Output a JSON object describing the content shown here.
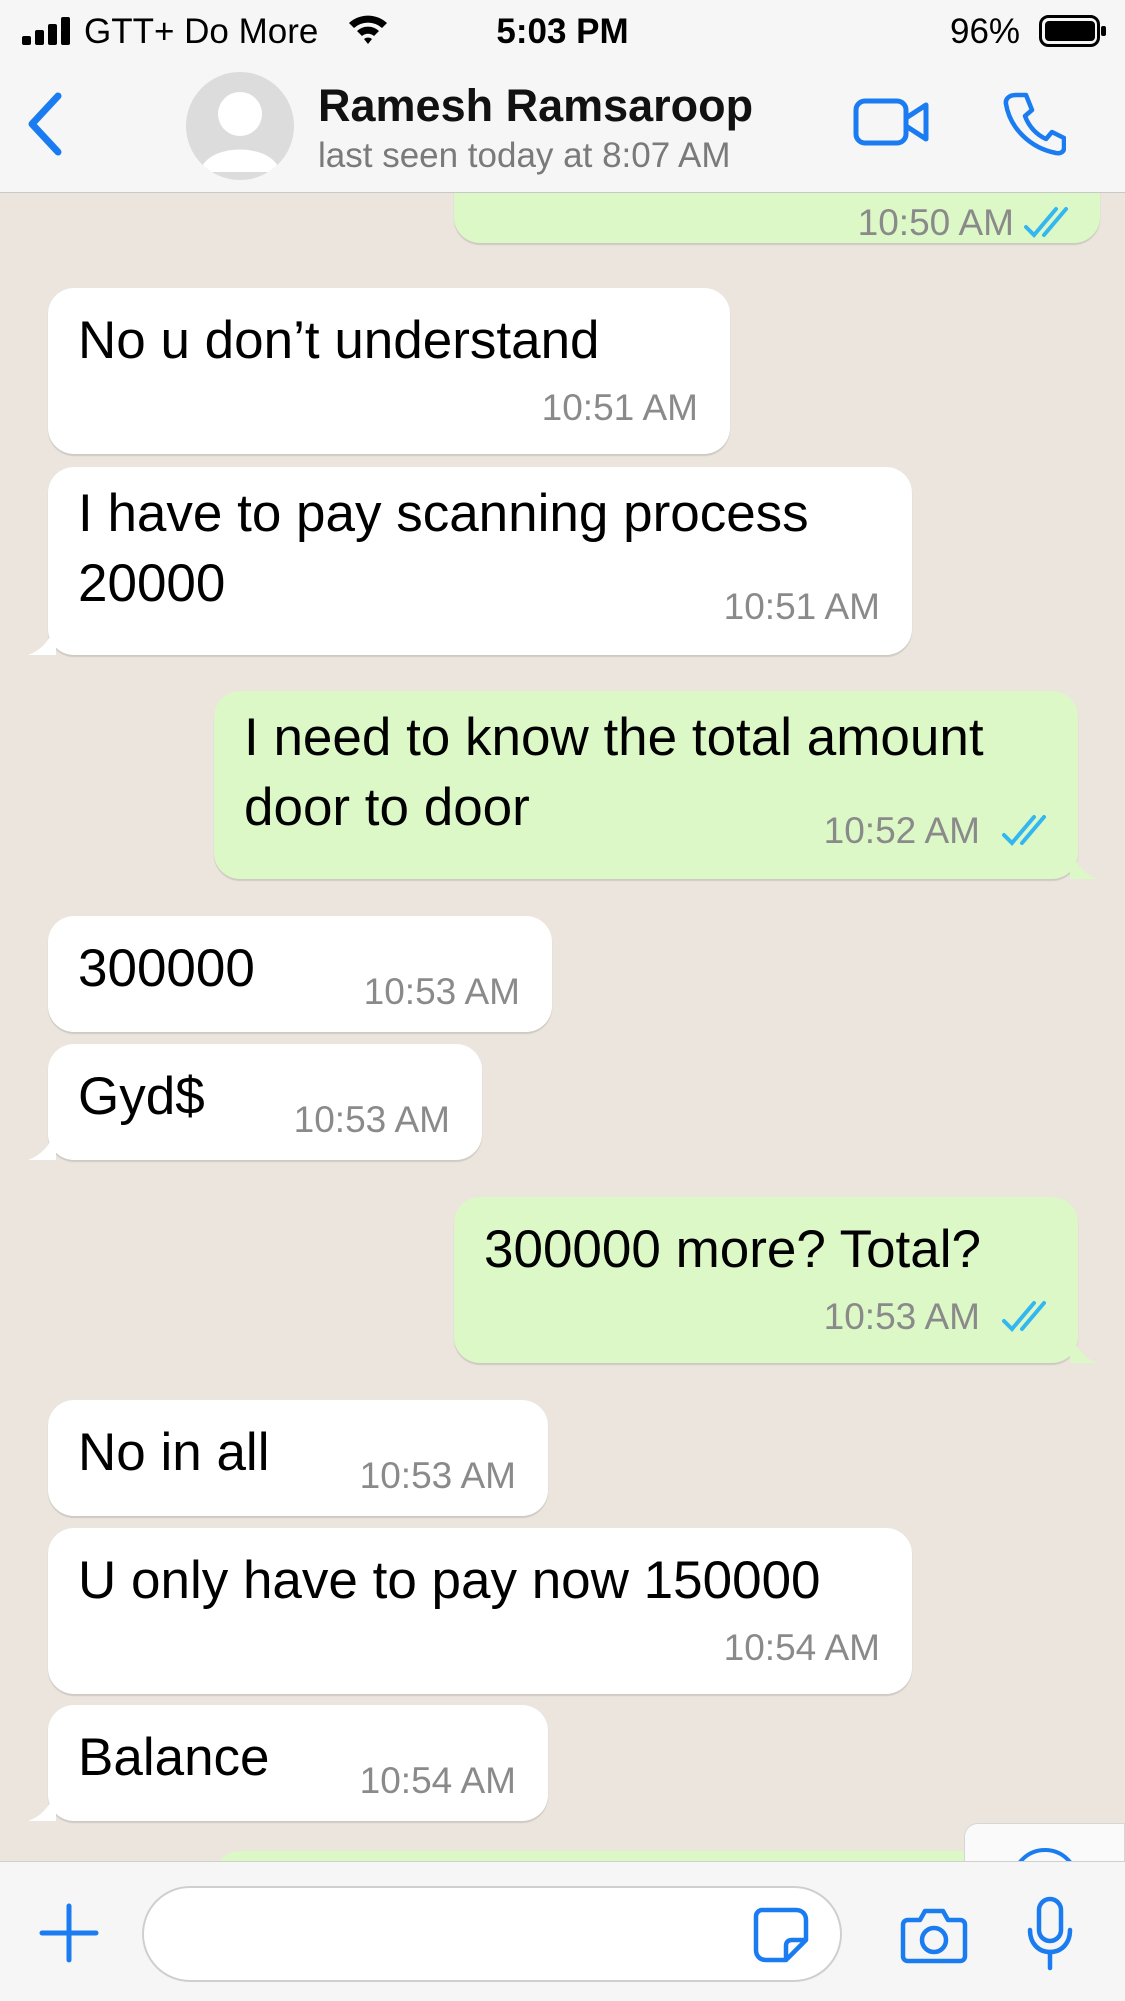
{
  "status_bar": {
    "carrier": "GTT+ Do More",
    "time": "5:03 PM",
    "battery": "96%"
  },
  "header": {
    "contact_name": "Ramesh Ramsaroop",
    "last_seen": "last seen today at 8:07 AM",
    "back_icon": "chevron-left-icon",
    "video_icon": "video-camera-icon",
    "call_icon": "phone-icon"
  },
  "colors": {
    "accent": "#1a7cf0",
    "outgoing_bubble": "#dcf8c6",
    "incoming_bubble": "#ffffff",
    "chat_background": "#ebe5de",
    "read_ticks": "#34b7f1"
  },
  "messages": [
    {
      "direction": "out",
      "text": "",
      "time": "10:50 AM",
      "status": "read"
    },
    {
      "direction": "in",
      "text": "No u don’t understand",
      "time": "10:51 AM"
    },
    {
      "direction": "in",
      "text_lines": [
        "I have to pay scanning process",
        "20000"
      ],
      "time": "10:51 AM"
    },
    {
      "direction": "out",
      "text_lines": [
        "I need to know the total amount",
        "door to door"
      ],
      "time": "10:52 AM",
      "status": "read"
    },
    {
      "direction": "in",
      "text": "300000",
      "time": "10:53 AM"
    },
    {
      "direction": "in",
      "text": "Gyd$",
      "time": "10:53 AM"
    },
    {
      "direction": "out",
      "text": "300000 more? Total?",
      "time": "10:53 AM",
      "status": "read"
    },
    {
      "direction": "in",
      "text": "No in all",
      "time": "10:53 AM"
    },
    {
      "direction": "in",
      "text": "U only have to pay now 150000",
      "time": "10:54 AM"
    },
    {
      "direction": "in",
      "text": "Balance",
      "time": "10:54 AM"
    }
  ],
  "input_bar": {
    "placeholder": "",
    "plus_icon": "plus-icon",
    "sticker_icon": "sticker-icon",
    "camera_icon": "camera-icon",
    "mic_icon": "microphone-icon"
  },
  "scroll_down_icon": "chevron-down-circle-icon"
}
